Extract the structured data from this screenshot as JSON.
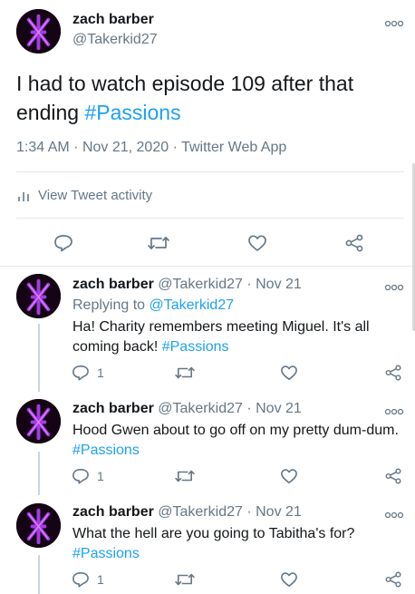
{
  "main_tweet": {
    "name": "zach barber",
    "handle": "@Takerkid27",
    "text": "I had to watch episode 109 after that",
    "text_line2": "ending",
    "hashtag": "#Passions",
    "time": "1:34 AM",
    "date": "Nov 21, 2020",
    "source": "Twitter Web App",
    "activity_label": "View Tweet activity"
  },
  "replies": [
    {
      "name": "zach barber",
      "handle": "@Takerkid27",
      "date": "Nov 21",
      "replying_prefix": "Replying to",
      "replying_to": "@Takerkid27",
      "line1": "Ha! Charity remembers meeting Miguel. It's all",
      "line2": "coming back!",
      "hashtag": "#Passions",
      "reply_count": "1"
    },
    {
      "name": "zach barber",
      "handle": "@Takerkid27",
      "date": "Nov 21",
      "line1": "Hood Gwen about to go off on my pretty dum-dum.",
      "hashtag": "#Passions",
      "reply_count": "1"
    },
    {
      "name": "zach barber",
      "handle": "@Takerkid27",
      "date": "Nov 21",
      "line1": "What the hell are you going to Tabitha's for?",
      "hashtag": "#Passions",
      "reply_count": "1"
    }
  ],
  "separator": "·",
  "colors": {
    "link": "#1da1f2",
    "secondary": "#657786",
    "avatar": "#9b30d9"
  }
}
